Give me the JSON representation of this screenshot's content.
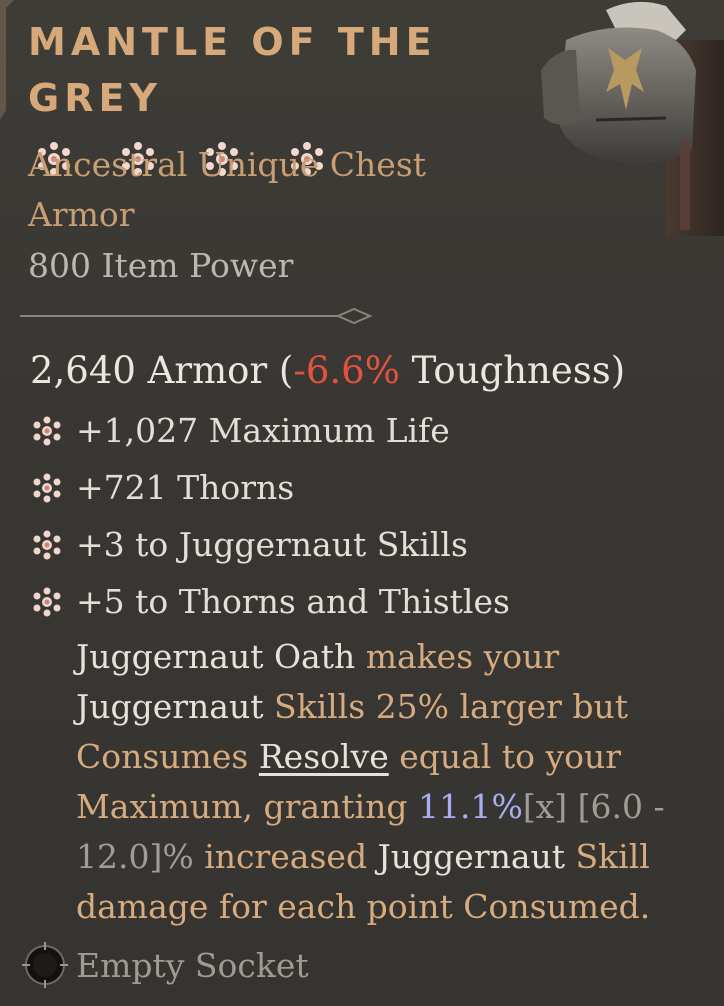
{
  "item": {
    "title": "MANTLE OF THE GREY",
    "gem_icon": "snowflake-gem-icon",
    "type": "Ancestral Unique Chest Armor",
    "item_power": "800 Item Power"
  },
  "stats": {
    "armor_value": "2,640 Armor (",
    "toughness_delta": "-6.6%",
    "toughness_label": " Toughness)"
  },
  "affixes": [
    {
      "text": "+1,027 Maximum Life"
    },
    {
      "text": "+721 Thorns"
    },
    {
      "text": "+3 to Juggernaut Skills"
    },
    {
      "text": "+5 to Thorns and Thistles"
    }
  ],
  "legendary": {
    "p1": "Juggernaut Oath",
    "p2": " makes your ",
    "p3": "Juggernaut",
    "p4": " Skills 25% larger but Consumes ",
    "p5": "Resolve",
    "p6": " equal to your Maximum, granting ",
    "p7": "11.1%",
    "p8": "[x] [6.0 - 12.0]%",
    "p9": " increased ",
    "p10": "Juggernaut",
    "p11": " Skill damage for each point Consumed."
  },
  "socket": {
    "label": "Empty Socket"
  },
  "colors": {
    "title": "#d7a97a",
    "type": "#c99e73",
    "negative": "#e2533f",
    "value_roll": "#a9aef4",
    "background": "#3b3935"
  }
}
